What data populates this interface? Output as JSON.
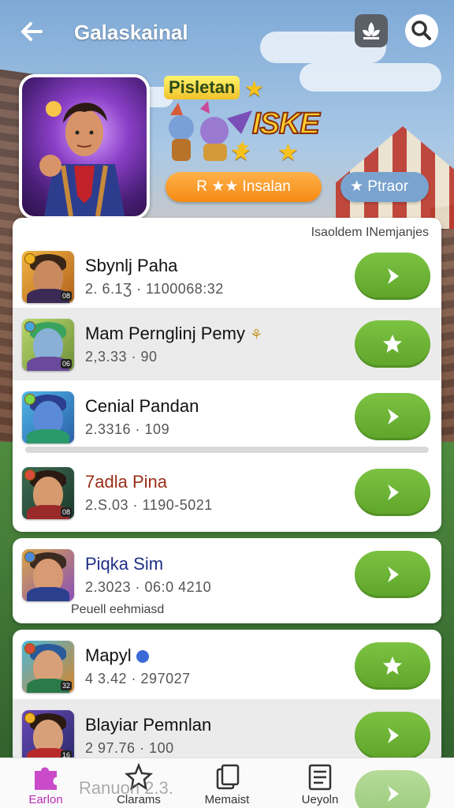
{
  "header": {
    "title": "Galaskainal"
  },
  "hero": {
    "label": "Pisletan",
    "logo_text": "ISKE",
    "primary_pill": "R ★★ Insalan",
    "secondary_pill": "★ Ptraor"
  },
  "list": {
    "header": "Isaoldem INemjanjes",
    "items": [
      {
        "name": "Sbynlj Paha",
        "meta": "2. 6.1Ʒ · 1100068:32",
        "action": "arrow",
        "name_color": "#111111"
      },
      {
        "name": "Mam Pernglinj Pemy",
        "name_suffix": "⚘",
        "meta": "2,3.33 · 90",
        "action": "star",
        "name_color": "#111111"
      },
      {
        "name": "Cenial Pandan",
        "meta": "2.3316 · 109",
        "action": "arrow",
        "name_color": "#111111"
      },
      {
        "name": "7adla Pina",
        "meta": "2.S.03 · 1190-5021",
        "action": "arrow",
        "name_color": "#9b2d17"
      }
    ]
  },
  "card2": {
    "item": {
      "name": "Piqka Sim",
      "meta": "2.3023 · 06:0 4210",
      "action": "arrow",
      "name_color": "#1f2f86"
    },
    "footnote": "Peuell eehmiasd"
  },
  "card3": {
    "items": [
      {
        "name": "Mapyl",
        "meta": "4 3.42 · 297027",
        "action": "star",
        "name_color": "#111111"
      },
      {
        "name": "Blayiar Pemnlan",
        "meta": "2 97.76 · 100",
        "action": "arrow",
        "name_color": "#111111"
      }
    ]
  },
  "ghost_row": "Ranuon 2.3.",
  "nav": {
    "items": [
      {
        "label": "Earlon",
        "icon": "puzzle-icon",
        "active": true
      },
      {
        "label": "Clarams",
        "icon": "star-outline-icon",
        "active": false
      },
      {
        "label": "Memaist",
        "icon": "cards-icon",
        "active": false
      },
      {
        "label": "Ueyoln",
        "icon": "list-icon",
        "active": false
      }
    ]
  },
  "colors": {
    "accent_green": "#6cb536",
    "accent_purple": "#b62fb8",
    "orange_pill": "#f58a12",
    "blue_pill": "#7aa3cf"
  }
}
